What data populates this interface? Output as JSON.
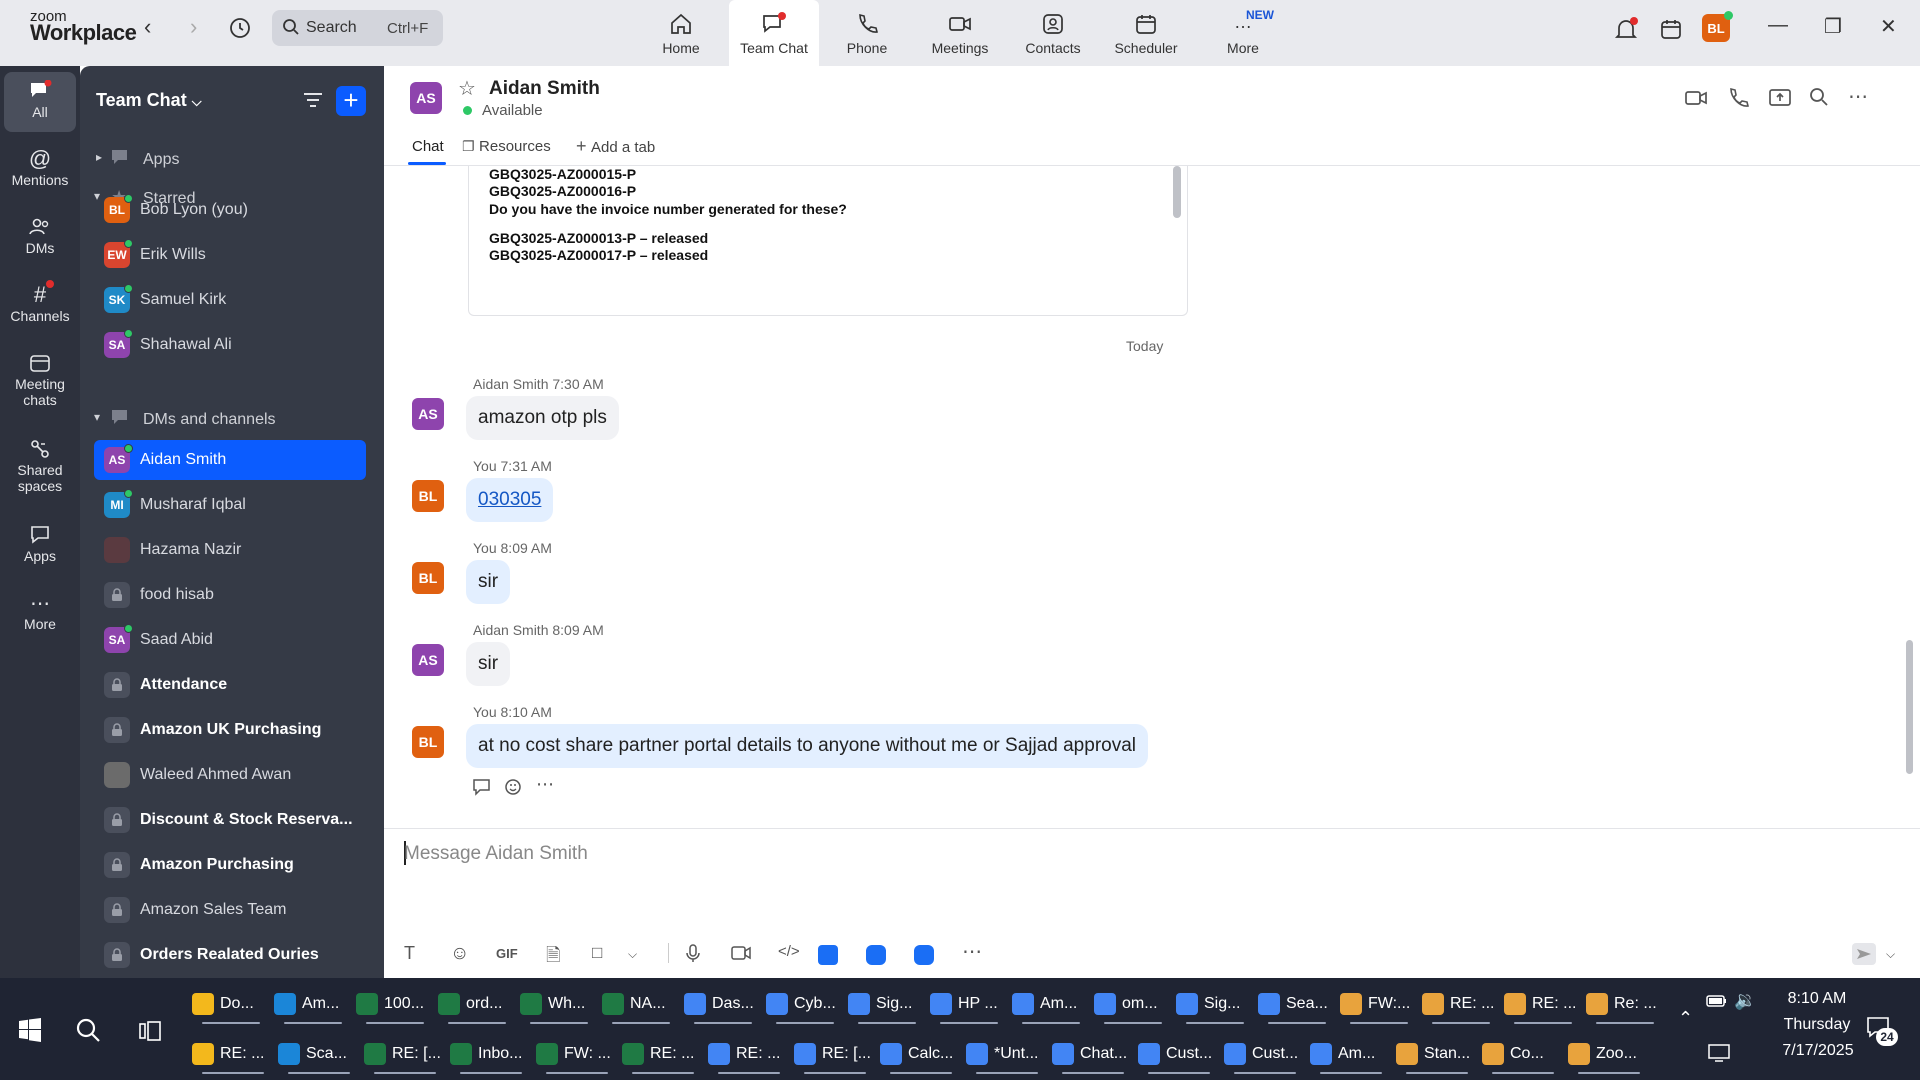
{
  "topbar": {
    "logo_small": "zoom",
    "logo_big": "Workplace",
    "search_label": "Search",
    "search_shortcut": "Ctrl+F",
    "nav": [
      {
        "label": "Home",
        "icon": "home-icon"
      },
      {
        "label": "Team Chat",
        "icon": "chat-icon",
        "active": true
      },
      {
        "label": "Phone",
        "icon": "phone-icon"
      },
      {
        "label": "Meetings",
        "icon": "video-icon"
      },
      {
        "label": "Contacts",
        "icon": "contacts-icon"
      },
      {
        "label": "Scheduler",
        "icon": "scheduler-icon"
      },
      {
        "label": "More",
        "icon": "more-icon",
        "badge": "NEW"
      }
    ],
    "user_initials": "BL"
  },
  "rail": [
    {
      "label": "All"
    },
    {
      "label": "Mentions"
    },
    {
      "label": "DMs"
    },
    {
      "label": "Channels"
    },
    {
      "label": "Meeting chats"
    },
    {
      "label": "Shared spaces"
    },
    {
      "label": "Apps"
    },
    {
      "label": "More"
    }
  ],
  "sidebar": {
    "title": "Team Chat",
    "apps_label": "Apps",
    "starred_label": "Starred",
    "dms_label": "DMs and channels",
    "starred": [
      {
        "initials": "BL",
        "name": "Bob Lyon (you)",
        "color": "#e06010"
      },
      {
        "initials": "EW",
        "name": "Erik Wills",
        "color": "#d9452f"
      },
      {
        "initials": "SK",
        "name": "Samuel Kirk",
        "color": "#1f8ac7"
      },
      {
        "initials": "SA",
        "name": "Shahawal Ali",
        "color": "#8e44ad"
      }
    ],
    "dms": [
      {
        "initials": "AS",
        "name": "Aidan Smith",
        "color": "#8e44ad",
        "active": true
      },
      {
        "initials": "MI",
        "name": "Musharaf Iqbal",
        "color": "#1f8ac7"
      },
      {
        "initials": "",
        "name": "Hazama Nazir",
        "color": "#5a3a40"
      },
      {
        "initials": "",
        "name": "food hisab",
        "lock": true
      },
      {
        "initials": "SA",
        "name": "Saad Abid",
        "color": "#8e44ad"
      },
      {
        "initials": "",
        "name": "Attendance",
        "lock": true,
        "bold": true
      },
      {
        "initials": "",
        "name": "Amazon UK Purchasing",
        "lock": true,
        "bold": true
      },
      {
        "initials": "",
        "name": "Waleed Ahmed Awan",
        "color": "#6b6b6b"
      },
      {
        "initials": "",
        "name": "Discount & Stock Reserva...",
        "lock": true,
        "bold": true
      },
      {
        "initials": "",
        "name": "Amazon Purchasing",
        "lock": true,
        "bold": true
      },
      {
        "initials": "",
        "name": "Amazon Sales Team",
        "lock": true
      },
      {
        "initials": "",
        "name": "Orders Realated Ouries",
        "lock": true,
        "bold": true
      }
    ]
  },
  "chat": {
    "contact_initials": "AS",
    "contact_name": "Aidan Smith",
    "contact_status": "Available",
    "tabs": [
      "Chat",
      "Resources",
      "Add a tab"
    ],
    "quote_lines": [
      "GBQ3025-AZ000015-P",
      "GBQ3025-AZ000016-P",
      "Do you have the invoice number generated for these?",
      "",
      "GBQ3025-AZ000013-P – released",
      "GBQ3025-AZ000017-P – released"
    ],
    "date_divider": "Today",
    "messages": [
      {
        "sender": "Aidan Smith",
        "initials": "AS",
        "time": "7:30 AM",
        "text": "amazon otp pls"
      },
      {
        "sender": "You",
        "initials": "BL",
        "time": "7:31 AM",
        "text": "030305"
      },
      {
        "sender": "You",
        "initials": "BL",
        "time": "8:09 AM",
        "text": "sir"
      },
      {
        "sender": "Aidan Smith",
        "initials": "AS",
        "time": "8:09 AM",
        "text": "sir"
      },
      {
        "sender": "You",
        "initials": "BL",
        "time": "8:10 AM",
        "text": "at no cost share partner portal details to anyone without me or Sajjad approval"
      }
    ],
    "compose_placeholder": "Message Aidan Smith",
    "gif_label": "GIF"
  },
  "taskbar": {
    "row1": [
      "Do...",
      "Am...",
      "100...",
      "ord...",
      "Wh...",
      "NA...",
      "Das...",
      "Cyb...",
      "Sig...",
      "HP ...",
      "Am...",
      "om...",
      "Sig...",
      "Sea...",
      "FW:...",
      "RE: ...",
      "RE: ...",
      "Re: ..."
    ],
    "row2": [
      "RE: ...",
      "Sca...",
      "RE: [...",
      "Inbo...",
      "FW: ...",
      "RE: ...",
      "RE: ...",
      "RE: [...",
      "Calc...",
      "*Unt...",
      "Chat...",
      "Cust...",
      "Cust...",
      "Am...",
      "Stan...",
      "Co...",
      "Zoo..."
    ],
    "time": "8:10 AM",
    "day": "Thursday",
    "date": "7/17/2025",
    "notif_count": "24"
  },
  "colors": {
    "accent": "#0b5cff",
    "rail_bg": "#2d313d",
    "sidelist_bg": "#353a46",
    "online": "#2ec866",
    "my_bubble": "#e3efff"
  }
}
